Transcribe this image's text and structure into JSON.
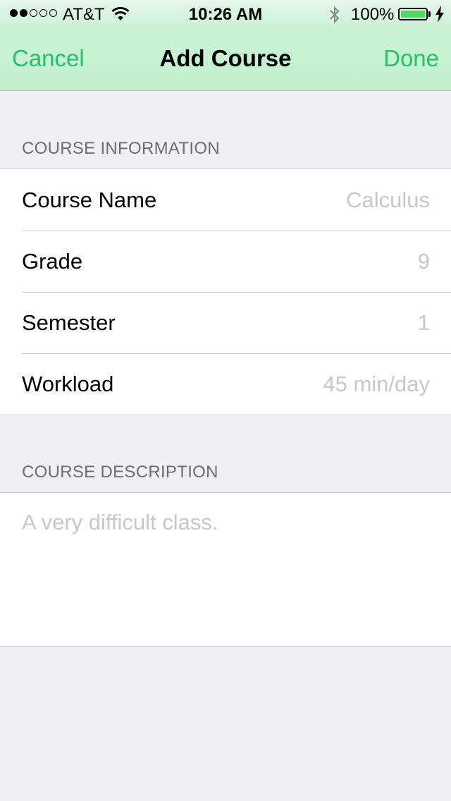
{
  "status_bar": {
    "carrier": "AT&T",
    "time": "10:26 AM",
    "battery_percent": "100%",
    "signal_bars_filled": 2,
    "signal_bars_total": 5,
    "icons": [
      "wifi-icon",
      "bluetooth-icon",
      "battery-icon",
      "charging-bolt-icon"
    ]
  },
  "nav": {
    "cancel_label": "Cancel",
    "title": "Add Course",
    "done_label": "Done",
    "accent_color": "#27c168"
  },
  "course_information": {
    "header": "COURSE INFORMATION",
    "fields": [
      {
        "label": "Course Name",
        "placeholder": "Calculus"
      },
      {
        "label": "Grade",
        "placeholder": "9"
      },
      {
        "label": "Semester",
        "placeholder": "1"
      },
      {
        "label": "Workload",
        "placeholder": "45 min/day"
      }
    ]
  },
  "course_description": {
    "header": "COURSE DESCRIPTION",
    "placeholder": "A very difficult class."
  }
}
